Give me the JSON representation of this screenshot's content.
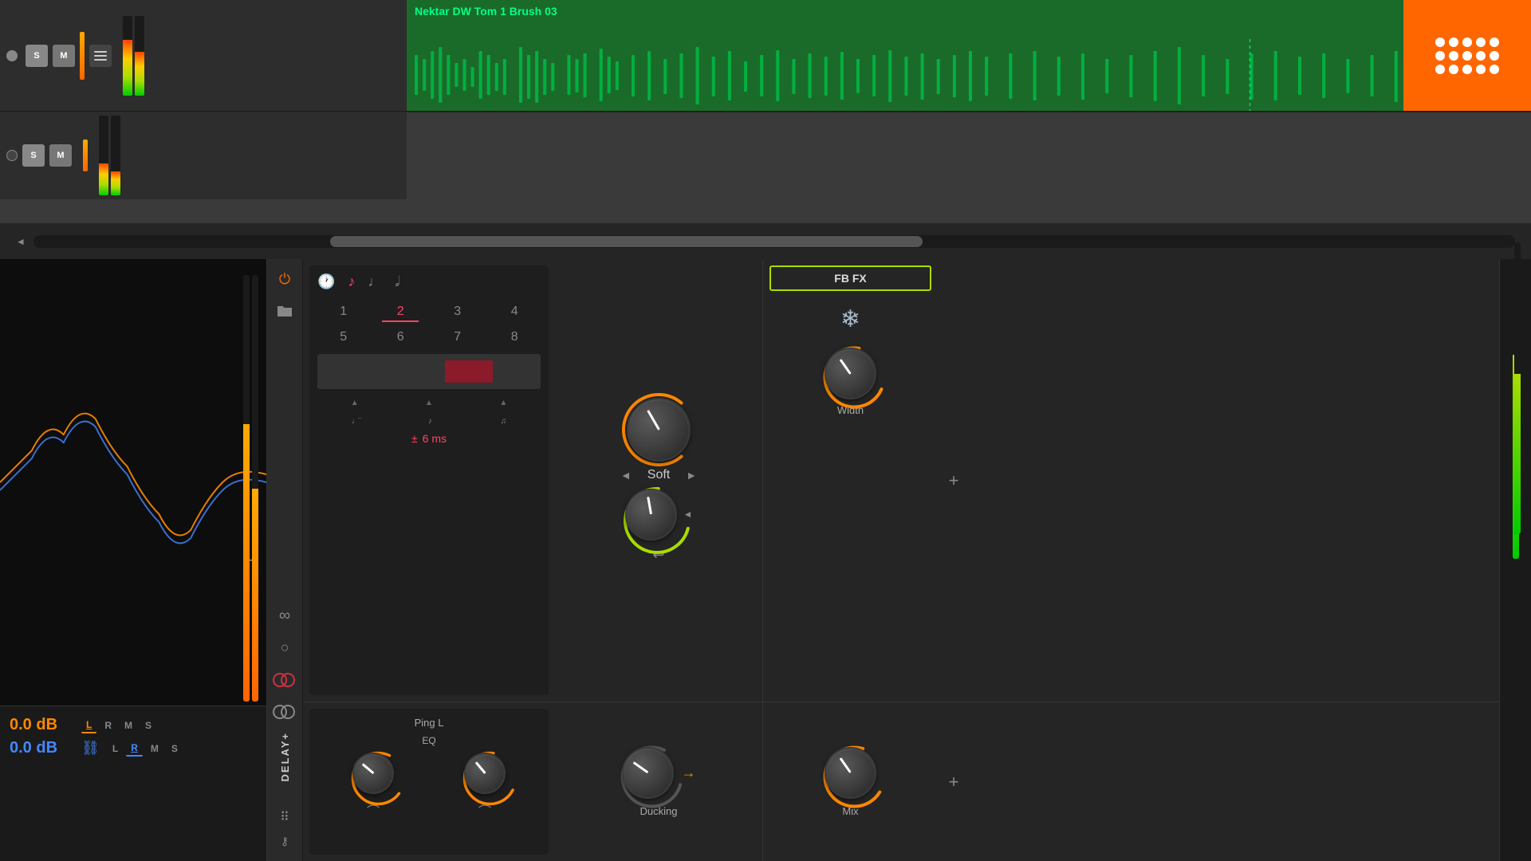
{
  "daw": {
    "track1": {
      "name": "Nektar DW Tom 1 Brush 03",
      "solo": "S",
      "mute": "M"
    },
    "track2": {
      "solo": "S",
      "mute": "M"
    }
  },
  "analyzer": {
    "db_orange": "0.0 dB",
    "db_blue": "0.0 dB",
    "l_label": "L",
    "r_label": "R",
    "m_label": "M",
    "s_label": "S"
  },
  "delay_plugin": {
    "name": "DELAY+",
    "note_icons": [
      "♩",
      "♪",
      "♫",
      "♬"
    ],
    "numbers_row1": [
      "1",
      "2",
      "3",
      "4"
    ],
    "numbers_row2": [
      "5",
      "6",
      "7",
      "8"
    ],
    "active_number": "2",
    "delay_ms": "6 ms",
    "delay_pm": "±",
    "ping_label": "Ping L",
    "eq_label": "EQ"
  },
  "soft_section": {
    "label": "Soft",
    "left_arrow": "◄",
    "right_arrow": "►"
  },
  "fb_fx": {
    "label": "FB FX"
  },
  "width_knob": {
    "label": "Width"
  },
  "ducking_knob": {
    "label": "Ducking"
  },
  "mix_knob": {
    "label": "Mix"
  },
  "icons": {
    "power": "⏻",
    "folder": "📁",
    "links": "∞",
    "circle": "○",
    "dots": "⠿",
    "key": "⚷",
    "plus": "+",
    "snow": "❄",
    "loop": "↩"
  },
  "colors": {
    "orange": "#ff6600",
    "green_accent": "#aadd00",
    "red_active": "#ff4466",
    "blue": "#4488ff",
    "gray_bg": "#252525",
    "dark_bg": "#1a1a1a"
  }
}
